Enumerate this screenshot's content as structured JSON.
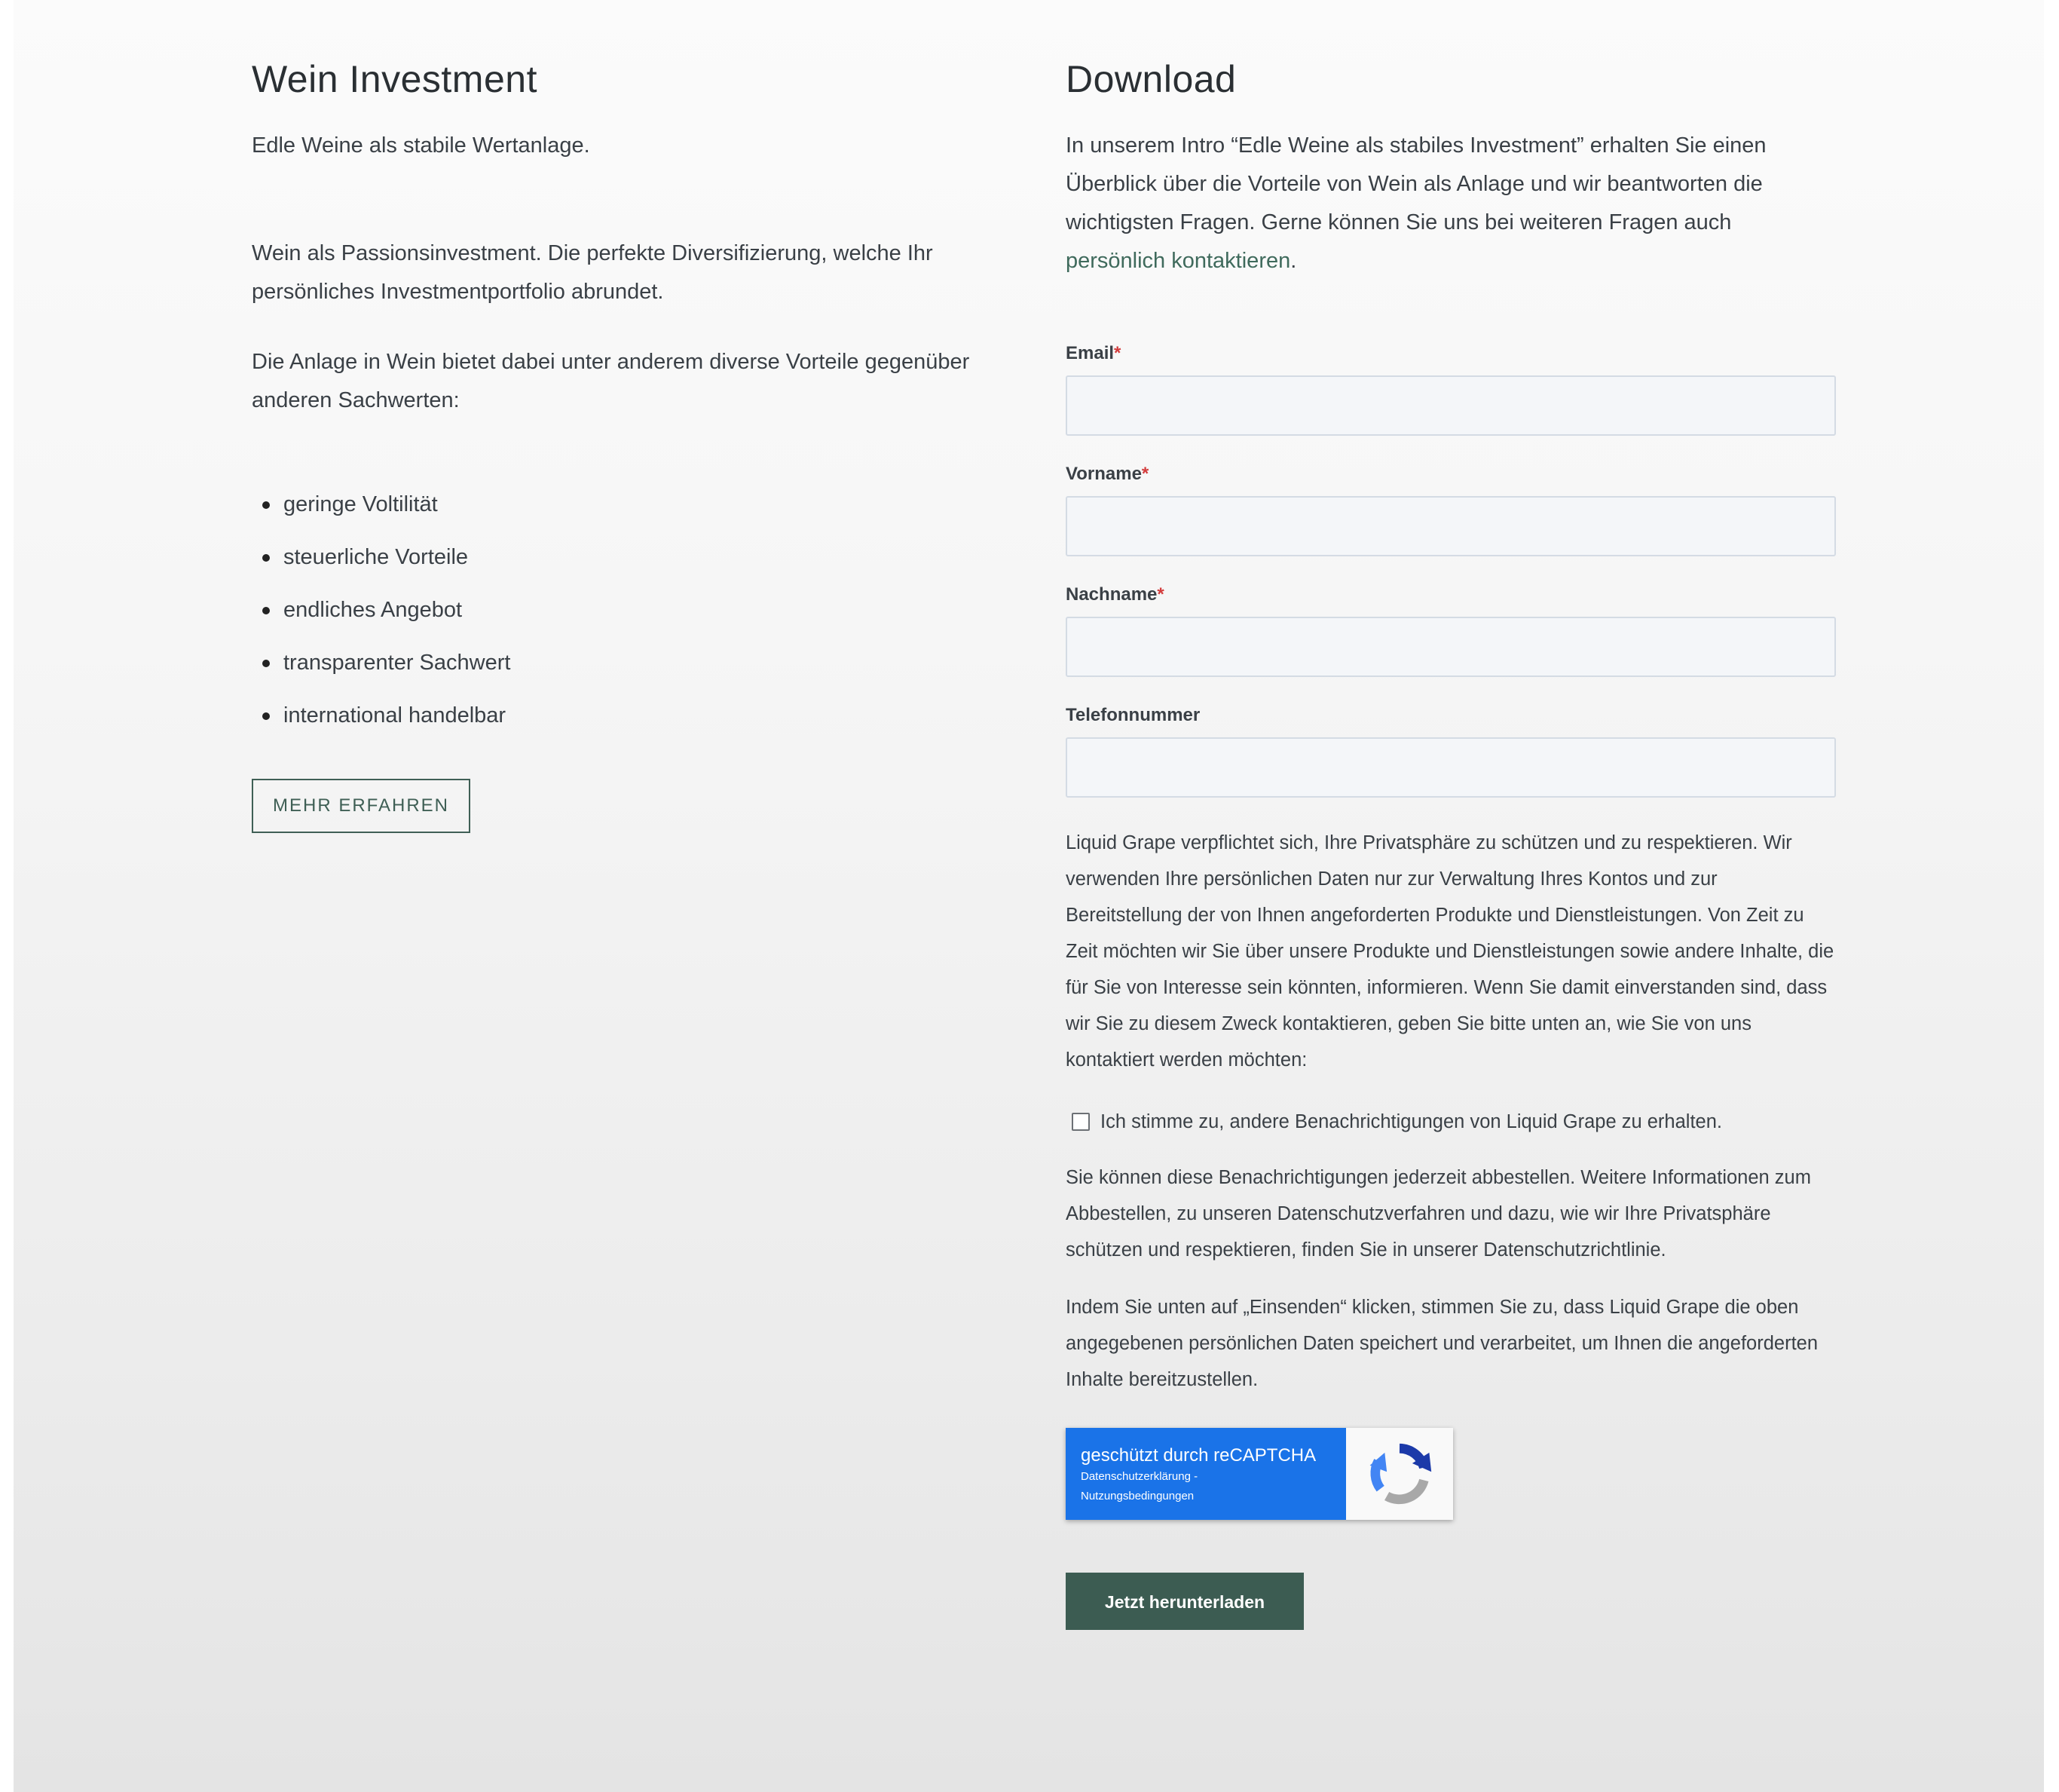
{
  "left": {
    "title": "Wein Investment",
    "lead": "Edle Weine als stabile Wertanlage.",
    "paragraph1": "Wein als Passionsinvestment. Die perfekte Diversifizierung, welche Ihr persönliches Investmentportfolio abrundet.",
    "paragraph2": "Die Anlage in Wein bietet dabei unter anderem diverse Vorteile gegenüber anderen Sachwerten:",
    "benefits": [
      "geringe Voltilität",
      "steuerliche Vorteile",
      "endliches Angebot",
      "transparenter Sachwert",
      "international handelbar"
    ],
    "more_button": "MEHR ERFAHREN"
  },
  "right": {
    "title": "Download",
    "intro_text": "In unserem Intro “Edle Weine als stabiles Investment” erhalten Sie einen Überblick über die Vorteile von Wein als Anlage und wir beantworten die wichtigsten Fragen. Gerne können Sie uns bei weiteren Fragen auch ",
    "intro_link": "persönlich kontaktieren",
    "intro_end": ".",
    "form": {
      "email_label": "Email",
      "firstname_label": "Vorname",
      "lastname_label": "Nachname",
      "phone_label": "Telefonnummer",
      "required_marker": "*",
      "email_value": "",
      "firstname_value": "",
      "lastname_value": "",
      "phone_value": ""
    },
    "privacy_text": "Liquid Grape verpflichtet sich, Ihre Privatsphäre zu schützen und zu respektieren. Wir verwenden Ihre persönlichen Daten nur zur Verwaltung Ihres Kontos und zur Bereitstellung der von Ihnen angeforderten Produkte und Dienstleistungen. Von Zeit zu Zeit möchten wir Sie über unsere Produkte und Dienstleistungen sowie andere Inhalte, die für Sie von Interesse sein könnten, informieren. Wenn Sie damit einverstanden sind, dass wir Sie zu diesem Zweck kontaktieren, geben Sie bitte unten an, wie Sie von uns kontaktiert werden möchten:",
    "consent_label": "Ich stimme zu, andere Benachrichtigungen von Liquid Grape zu erhalten.",
    "unsubscribe_text": "Sie können diese Benachrichtigungen jederzeit abbestellen. Weitere Informationen zum Abbestellen, zu unseren Datenschutzverfahren und dazu, wie wir Ihre Privatsphäre schützen und respektieren, finden Sie in unserer Datenschutzrichtlinie.",
    "submit_notice": "Indem Sie unten auf „Einsenden“ klicken, stimmen Sie zu, dass Liquid Grape die oben angegebenen persönlichen Daten speichert und verarbeitet, um Ihnen die angeforderten Inhalte bereitzustellen.",
    "recaptcha": {
      "title": "geschützt durch reCAPTCHA",
      "privacy": "Datenschutzerklärung",
      "separator": " - ",
      "terms": "Nutzungsbedingungen",
      "icon": "recaptcha-logo-icon",
      "color": "#1a73e8"
    },
    "submit_button": "Jetzt herunterladen"
  },
  "colors": {
    "accent": "#3c5c52",
    "link": "#3f6a5c",
    "required": "#d33c3c"
  }
}
